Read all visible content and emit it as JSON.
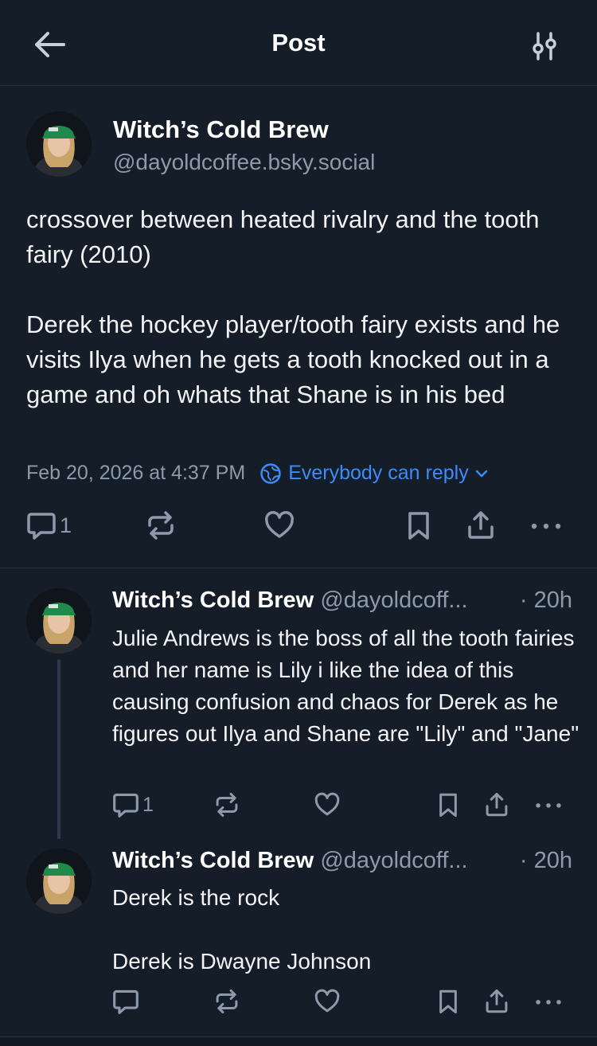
{
  "header": {
    "title": "Post",
    "back_icon": "arrow-left-icon",
    "settings_icon": "sliders-icon"
  },
  "post": {
    "author": "Witch’s Cold Brew",
    "handle": "@dayoldcoffee.bsky.social",
    "text_paragraphs": [
      "crossover between heated rivalry and the tooth fairy (2010)",
      "Derek the hockey player/tooth fairy exists and he visits Ilya when he gets a tooth knocked out in a game and oh whats that Shane is in his bed"
    ],
    "timestamp": "Feb 20, 2026 at 4:37 PM",
    "reply_setting": "Everybody can reply",
    "reply_count": "1"
  },
  "replies": [
    {
      "author": "Witch’s Cold Brew",
      "handle": "@dayoldcoff...",
      "time": "· 20h",
      "text_paragraphs": [
        "Julie Andrews is the boss of all the tooth fairies and her name is Lily i like the idea of this causing confusion and chaos for Derek as he figures out Ilya and Shane are \"Lily\" and \"Jane\""
      ],
      "reply_count": "1"
    },
    {
      "author": "Witch’s Cold Brew",
      "handle": "@dayoldcoff...",
      "time": "· 20h",
      "text_paragraphs": [
        "Derek is the rock",
        "Derek is Dwayne Johnson"
      ],
      "reply_count": ""
    }
  ],
  "colors": {
    "background": "#151d28",
    "text": "#f1f3f5",
    "muted": "#8d9aab",
    "accent": "#3d8bf7",
    "divider": "#283445"
  }
}
